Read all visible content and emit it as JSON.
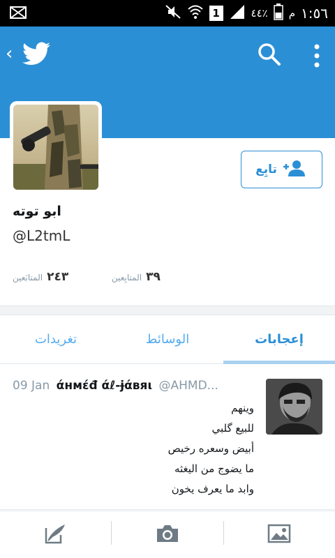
{
  "status_bar": {
    "time": "١:٥٦",
    "ampm": "م",
    "battery_percent": "٤٤٪",
    "sim_badge": "1",
    "icons": [
      "mail-icon",
      "mute-icon",
      "wifi-icon",
      "signal-icon",
      "battery-icon"
    ]
  },
  "header": {
    "background_color": "#2b8fd6",
    "icons": [
      "back-chevron-icon",
      "twitter-bird-icon",
      "search-icon",
      "overflow-menu-icon"
    ]
  },
  "profile": {
    "display_name": "ابو توته",
    "handle": "@L2tmL",
    "follow_button_label": "تابِع",
    "stats": [
      {
        "value": "٢٤٣",
        "label": "المتابَعين"
      },
      {
        "value": "٣٩",
        "label": "المتابِعين"
      }
    ]
  },
  "tabs": [
    {
      "label": "تغريدات",
      "active": false
    },
    {
      "label": "الوسائط",
      "active": false
    },
    {
      "label": "إعجابات",
      "active": true
    }
  ],
  "tweet": {
    "date": "09 Jan",
    "author_name": "άнмέđ άℓ-ɉάвяι",
    "author_handle": "@AHMD...",
    "lines": [
      "وينهم",
      "للبيع گلبي",
      "أبيض وسعره رخيص",
      "ما يضوج من اليغثه",
      "وابد ما يعرف يخون"
    ]
  },
  "bottom_bar": {
    "icons": [
      "compose-tweet-icon",
      "camera-icon",
      "gallery-icon"
    ]
  },
  "colors": {
    "accent": "#2b8fd6",
    "tab_text": "#55acee",
    "muted_text": "#8899a6"
  }
}
